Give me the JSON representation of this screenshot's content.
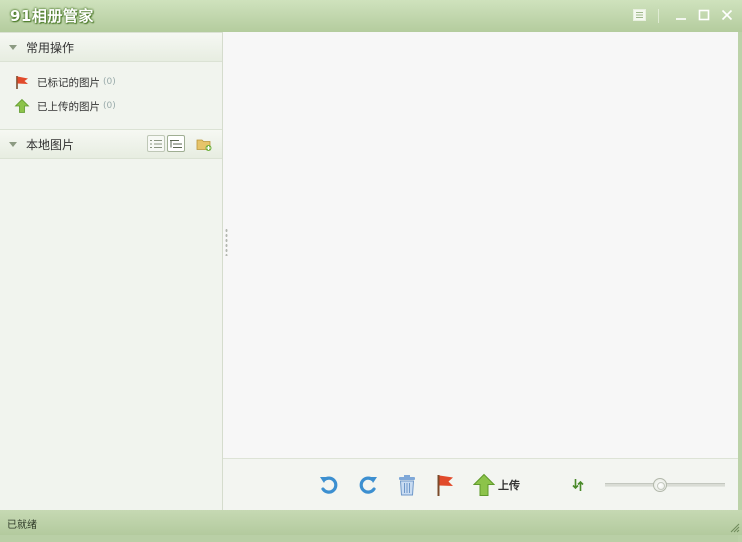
{
  "window": {
    "title": "91相册管家"
  },
  "sidebar": {
    "common_ops": {
      "title": "常用操作",
      "items": [
        {
          "label": "已标记的图片",
          "count": "(0)",
          "icon": "red-flag-icon"
        },
        {
          "label": "已上传的图片",
          "count": "(0)",
          "icon": "upload-arrow-icon"
        }
      ]
    },
    "local_pictures": {
      "title": "本地图片"
    }
  },
  "toolbar": {
    "upload_label": "上传",
    "zoom_level": 0.45
  },
  "status": {
    "text": "已就绪"
  },
  "colors": {
    "accent_green": "#6fae3c",
    "flag_red": "#e14a2b",
    "rotate_blue": "#3c8fd0",
    "titlebar": "#bcd2a9"
  }
}
